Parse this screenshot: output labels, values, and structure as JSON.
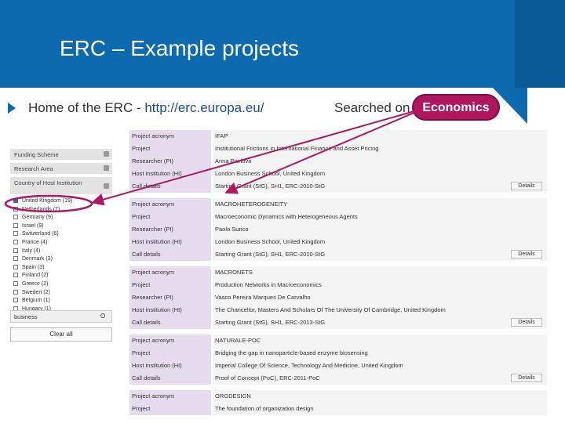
{
  "slide": {
    "title": "ERC – Example projects",
    "bullet_prefix": "Home of the ERC - ",
    "bullet_link": "http://erc.europa.eu/",
    "searched_label": "Searched on",
    "searched_term": "Economics"
  },
  "filters": {
    "funding_scheme": "Funding Scheme",
    "research_area": "Research Area",
    "country_host": "Country of Host Institution",
    "countries": [
      "United Kingdom (19)",
      "Netherlands (7)",
      "Germany (9)",
      "Israel (8)",
      "Switzerland (6)",
      "France (4)",
      "Italy (4)",
      "Denmark (3)",
      "Spain (3)",
      "Finland (2)",
      "Greece (2)",
      "Sweden (2)",
      "Belgium (1)",
      "Hungary (1)"
    ],
    "search_value": "business",
    "clear_all": "Clear all"
  },
  "results": {
    "details_label": "Details",
    "projects": [
      {
        "rows": [
          {
            "label": "Project acronym",
            "value": "IFAP"
          },
          {
            "label": "Project",
            "value": "Institutional Frictions in International Finance and Asset Pricing"
          },
          {
            "label": "Researcher (PI)",
            "value": "Anna Pavlova"
          },
          {
            "label": "Host institution (HI)",
            "value": "London Business School, United Kingdom"
          },
          {
            "label": "Call details",
            "value": "Starting Grant (StG), SH1, ERC-2010-StG"
          }
        ]
      },
      {
        "rows": [
          {
            "label": "Project acronym",
            "value": "MACROHETEROGENEITY"
          },
          {
            "label": "Project",
            "value": "Macroeconomic Dynamics with Heterogeneous Agents"
          },
          {
            "label": "Researcher (PI)",
            "value": "Paolo Surico"
          },
          {
            "label": "Host institution (HI)",
            "value": "London Business School, United Kingdom"
          },
          {
            "label": "Call details",
            "value": "Starting Grant (StG), SH1, ERC-2010-StG"
          }
        ]
      },
      {
        "rows": [
          {
            "label": "Project acronym",
            "value": "MACRONETS"
          },
          {
            "label": "Project",
            "value": "Production Networks in Macroeconomics"
          },
          {
            "label": "Researcher (PI)",
            "value": "Vasco Pereira Marques De Carvalho"
          },
          {
            "label": "Host institution (HI)",
            "value": "The Chancellor, Masters And Scholars Of The University Of Cambridge, United Kingdom"
          },
          {
            "label": "Call details",
            "value": "Starting Grant (StG), SH1, ERC-2013-StG"
          }
        ]
      },
      {
        "rows": [
          {
            "label": "Project acronym",
            "value": "NATURALE-POC"
          },
          {
            "label": "Project",
            "value": "Bridging the gap in nanoparticle-based enzyme biosensing"
          },
          {
            "label": "Host institution (HI)",
            "value": "Imperial College Of Science, Technology And Medicine, United Kingdom"
          },
          {
            "label": "Call details",
            "value": "Proof of Concept (PoC), ERC-2011-PoC"
          }
        ]
      },
      {
        "rows": [
          {
            "label": "Project acronym",
            "value": "ORGDESIGN"
          },
          {
            "label": "Project",
            "value": "The foundation of organization design"
          }
        ]
      }
    ]
  },
  "colors": {
    "header_blue": "#0d6aae",
    "highlight": "#b0155f",
    "label_cell": "#e6dcee"
  }
}
